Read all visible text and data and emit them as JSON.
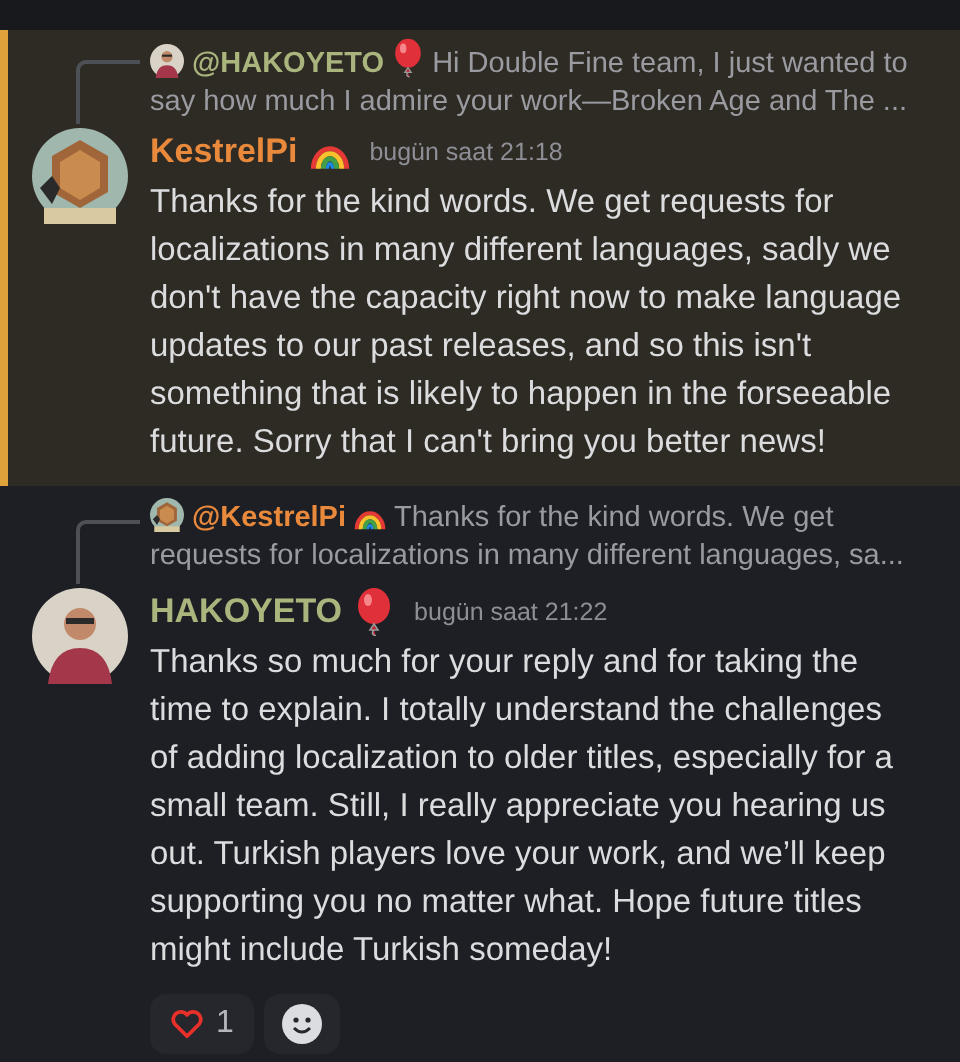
{
  "messages": [
    {
      "highlighted": true,
      "reply": {
        "author": "@HAKOYETO",
        "color": "#a9b57c",
        "kind": "balloon",
        "text": "Hi Double Fine team,  I just wanted to say how much I admire your work—Broken Age and The ..."
      },
      "author": "KestrelPi",
      "color": "#e8893c",
      "kind": "rainbow",
      "timestamp": "bugün saat 21:18",
      "text": "Thanks for the kind words. We get requests for localizations in many different languages, sadly we don't have the capacity right now to make language updates to our past releases, and so this isn't something that is likely to happen in the forseeable future. Sorry that I can't bring you better news!"
    },
    {
      "highlighted": false,
      "reply": {
        "author": "@KestrelPi",
        "color": "#e8893c",
        "kind": "rainbow",
        "text": "Thanks for the kind words. We get requests for localizations in many different languages, sa..."
      },
      "author": "HAKOYETO",
      "color": "#a9b57c",
      "kind": "balloon",
      "timestamp": "bugün saat 21:22",
      "text": "Thanks so much for your reply and for taking the time to explain. I totally understand the challenges of adding localization to older titles, especially for a small team. Still, I really appreciate you hearing us out. Turkish players love your work, and we’ll keep supporting you no matter what. Hope future titles might include Turkish someday!",
      "reactions": [
        {
          "count": "1",
          "selected": false
        }
      ]
    }
  ]
}
